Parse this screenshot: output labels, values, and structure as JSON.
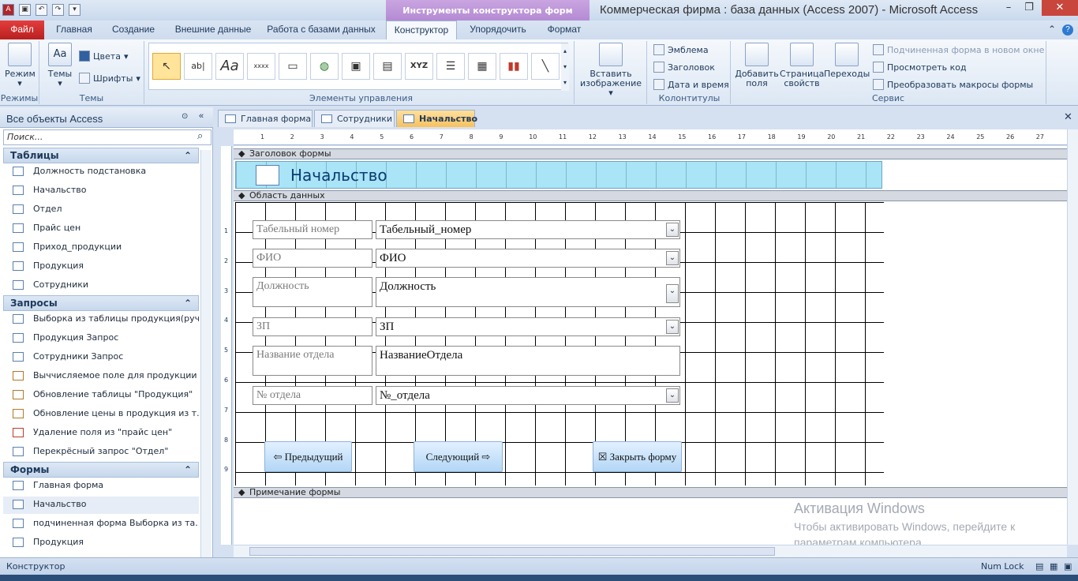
{
  "window": {
    "title": "Коммерческая фирма : база данных (Access 2007)  -  Microsoft Access",
    "context_tab": "Инструменты конструктора форм"
  },
  "ribbon_tabs": [
    "Файл",
    "Главная",
    "Создание",
    "Внешние данные",
    "Работа с базами данных",
    "Конструктор",
    "Упорядочить",
    "Формат"
  ],
  "ribbon": {
    "views": {
      "label": "Режимы",
      "btn": "Режим"
    },
    "themes": {
      "label": "Темы",
      "themes_btn": "Темы",
      "colors": "Цвета",
      "fonts": "Шрифты"
    },
    "controls": {
      "label": "Элементы управления",
      "textbox": "ab|",
      "text": "Aa",
      "button": "xxxx",
      "xyz": "XYZ"
    },
    "insert_image": {
      "line1": "Вставить",
      "line2": "изображение"
    },
    "header_footer": {
      "label": "Колонтитулы",
      "logo": "Эмблема",
      "title": "Заголовок",
      "datetime": "Дата и время"
    },
    "tools": {
      "label": "Сервис",
      "add_fields_1": "Добавить",
      "add_fields_2": "поля",
      "props_1": "Страница",
      "props_2": "свойств",
      "tab_order": "Переходы",
      "subform": "Подчиненная форма в новом окне",
      "view_code": "Просмотреть код",
      "convert_macros": "Преобразовать макросы формы"
    }
  },
  "nav": {
    "header": "Все объекты Access",
    "search_placeholder": "Поиск...",
    "sections": [
      {
        "title": "Таблицы",
        "items": [
          "Должность подстановка",
          "Начальство",
          "Отдел",
          "Прайс цен",
          "Приход_продукции",
          "Продукция",
          "Сотрудники"
        ]
      },
      {
        "title": "Запросы",
        "items": [
          "Выборка из таблицы продукция(руч...",
          "Продукция Запрос",
          "Сотрудники Запрос",
          "Выччисляемое поле для продукции",
          "Обновление таблицы \"Продукция\"",
          "Обновление цены в продукция из т...",
          "Удаление поля из \"прайс цен\"",
          "Перекрёсный запрос \"Отдел\""
        ]
      },
      {
        "title": "Формы",
        "items": [
          "Главная форма",
          "Начальство",
          "подчиненная форма Выборка из та...",
          "Продукция"
        ]
      }
    ]
  },
  "doc_tabs": [
    "Главная форма",
    "Сотрудники",
    "Начальство"
  ],
  "ruler_marks": [
    "1",
    "2",
    "3",
    "4",
    "5",
    "6",
    "7",
    "8",
    "9",
    "10",
    "11",
    "12",
    "13",
    "14",
    "15",
    "16",
    "17",
    "18",
    "19",
    "20",
    "21",
    "22",
    "23",
    "24",
    "25",
    "26",
    "27"
  ],
  "left_ruler_marks": [
    "1",
    "2",
    "3",
    "4",
    "5",
    "6",
    "7",
    "8",
    "9"
  ],
  "form": {
    "header_section": "Заголовок формы",
    "detail_section": "Область данных",
    "footer_section": "Примечание формы",
    "title": "Начальство",
    "fields": [
      {
        "label": "Табельный номер",
        "value": "Табельный_номер",
        "dropdown": true
      },
      {
        "label": "ФИО",
        "value": "ФИО",
        "dropdown": true
      },
      {
        "label": "Должность",
        "value": "Должность",
        "dropdown": true
      },
      {
        "label": "ЗП",
        "value": "ЗП",
        "dropdown": true
      },
      {
        "label": "Название отдела",
        "value": "НазваниеОтдела",
        "dropdown": false
      },
      {
        "label": "№ отдела",
        "value": "№_отдела",
        "dropdown": true
      }
    ],
    "buttons": {
      "prev": "⇦ Предыдущий",
      "next": "Следующий ⇨",
      "close": "☒ Закрыть форму"
    }
  },
  "watermark": {
    "line1": "Активация Windows",
    "line2": "Чтобы активировать Windows, перейдите к параметрам компьютера."
  },
  "status": {
    "mode": "Конструктор",
    "numlock": "Num Lock"
  }
}
